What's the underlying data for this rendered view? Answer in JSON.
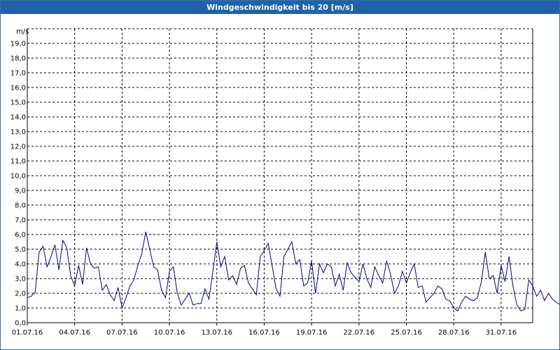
{
  "window": {
    "title": "Windgeschwindigkeit bis 20 [m/s]"
  },
  "colors": {
    "titlebar": "#1f63a7",
    "series": "#00008b",
    "grid": "#000000"
  },
  "chart_data": {
    "type": "line",
    "title": "Windgeschwindigkeit bis 20 [m/s]",
    "ylabel": "m/s",
    "xlabel": "",
    "ylim": [
      0,
      20
    ],
    "y_ticks": [
      "0,0",
      "1,0",
      "2,0",
      "3,0",
      "4,0",
      "5,0",
      "6,0",
      "7,0",
      "8,0",
      "9,0",
      "10,0",
      "11,0",
      "12,0",
      "13,0",
      "14,0",
      "15,0",
      "16,0",
      "17,0",
      "18,0",
      "19,0"
    ],
    "x_start": "01.07.16",
    "x_end": "02.08.16",
    "x_ticks": [
      "01.07.16",
      "04.07.16",
      "07.07.16",
      "10.07.16",
      "13.07.16",
      "16.07.16",
      "19.07.16",
      "22.07.16",
      "25.07.16",
      "28.07.16",
      "31.07.16"
    ],
    "grid": true,
    "series": [
      {
        "sample_interval_days": 0.25,
        "values": [
          1.7,
          1.8,
          2.1,
          4.8,
          5.2,
          3.8,
          4.5,
          5.3,
          3.6,
          5.6,
          5.1,
          3.2,
          2.5,
          3.9,
          2.6,
          5.1,
          4.0,
          3.7,
          3.8,
          2.2,
          2.6,
          1.9,
          1.5,
          2.4,
          1.0,
          1.7,
          2.5,
          2.9,
          3.9,
          4.7,
          6.2,
          5.0,
          3.8,
          3.6,
          2.2,
          1.7,
          3.5,
          3.8,
          2.0,
          1.2,
          1.6,
          2.0,
          1.2,
          1.3,
          1.3,
          2.3,
          1.6,
          3.5,
          5.5,
          3.8,
          4.5,
          2.9,
          3.2,
          2.6,
          3.7,
          3.9,
          2.7,
          2.3,
          1.9,
          4.5,
          4.9,
          5.4,
          3.9,
          2.3,
          1.8,
          4.5,
          5.0,
          5.5,
          4.0,
          4.3,
          2.5,
          2.7,
          4.2,
          2.0,
          4.0,
          3.4,
          4.0,
          3.8,
          2.5,
          3.3,
          2.2,
          4.1,
          3.4,
          3.1,
          2.8,
          4.0,
          3.0,
          2.4,
          3.8,
          3.2,
          2.7,
          4.2,
          3.3,
          2.0,
          2.5,
          3.5,
          2.7,
          3.4,
          4.0,
          2.4,
          2.5,
          1.4,
          1.7,
          2.0,
          2.5,
          2.3,
          1.6,
          1.5,
          1.0,
          0.8,
          1.4,
          1.8,
          1.6,
          1.5,
          1.7,
          2.8,
          4.8,
          3.0,
          3.2,
          2.0,
          3.9,
          2.8,
          4.5,
          2.5,
          1.2,
          0.8,
          0.9,
          2.9,
          2.5,
          1.8,
          2.2,
          1.5,
          2.0,
          1.6,
          1.4,
          1.2,
          1.6,
          1.1,
          1.5,
          2.1,
          2.8,
          2.3,
          2.0,
          2.9,
          3.4,
          3.0,
          2.4,
          1.8,
          2.5,
          1.4,
          1.5,
          1.3,
          1.7,
          1.9,
          1.3,
          1.2,
          2.4,
          4.6,
          5.2,
          3.8,
          4.9,
          3.0,
          4.5,
          5.4,
          4.2,
          2.8,
          2.4,
          2.6,
          5.2,
          3.5,
          2.3,
          4.1,
          5.5,
          2.5,
          1.1,
          3.6,
          4.9,
          4.1,
          2.8,
          3.7,
          2.4,
          3.0,
          3.5,
          3.2,
          2.7,
          3.9,
          1.9,
          1.4
        ]
      }
    ]
  }
}
